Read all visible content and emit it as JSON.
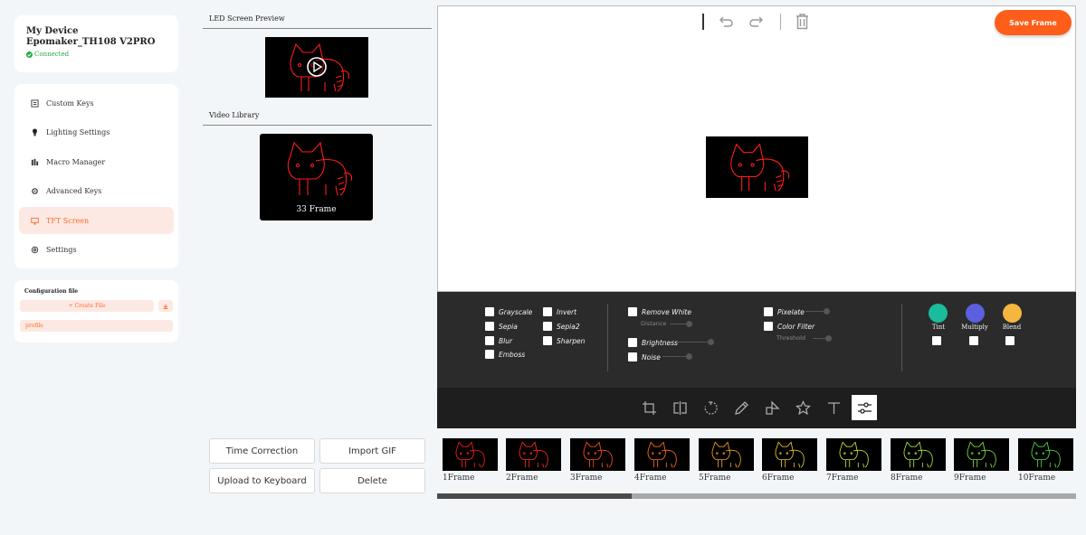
{
  "device": {
    "name": "My Device Epomaker_TH108 V2PRO",
    "status": "Connected",
    "status_color": "#27a745"
  },
  "nav": {
    "items": [
      {
        "label": "Custom Keys",
        "icon": "keys-icon"
      },
      {
        "label": "Lighting Settings",
        "icon": "bulb-icon"
      },
      {
        "label": "Macro Manager",
        "icon": "macro-icon"
      },
      {
        "label": "Advanced Keys",
        "icon": "gear-icon"
      },
      {
        "label": "TFT Screen",
        "icon": "monitor-icon",
        "active": true
      },
      {
        "label": "Settings",
        "icon": "settings-icon"
      }
    ]
  },
  "config": {
    "title": "Configuration file",
    "create_label": "Create File",
    "profile": "profile"
  },
  "preview": {
    "title": "LED Screen Preview"
  },
  "library": {
    "title": "Video Library",
    "item_label": "33 Frame"
  },
  "actions": {
    "time_correction": "Time Correction",
    "import_gif": "Import GIF",
    "upload": "Upload to Keyboard",
    "delete": "Delete"
  },
  "editor": {
    "save_label": "Save Frame",
    "accent": "#ff5d1a"
  },
  "filters": {
    "grayscale": "Grayscale",
    "sepia": "Sepia",
    "blur": "Blur",
    "emboss": "Emboss",
    "invert": "Invert",
    "sepia2": "Sepia2",
    "sharpen": "Sharpen",
    "remove_white": "Remove White",
    "distance": "Distance",
    "brightness": "Brightness",
    "noise": "Noise",
    "pixelate": "Pixelate",
    "color_filter": "Color Filter",
    "threshold": "Threshold"
  },
  "blend": [
    {
      "label": "Tint",
      "color": "#1abc9c"
    },
    {
      "label": "Multiply",
      "color": "#5b5fe0"
    },
    {
      "label": "Blend",
      "color": "#f5b63f"
    }
  ],
  "tools": [
    "crop-icon",
    "flip-icon",
    "rotate-icon",
    "pencil-icon",
    "shapes-icon",
    "star-icon",
    "text-icon",
    "sliders-icon"
  ],
  "frames": [
    {
      "label": "1Frame",
      "color": "#ff1a1a"
    },
    {
      "label": "2Frame",
      "color": "#ff2a1a"
    },
    {
      "label": "3Frame",
      "color": "#ff4a1a"
    },
    {
      "label": "4Frame",
      "color": "#ff6e1a"
    },
    {
      "label": "5Frame",
      "color": "#f0a020"
    },
    {
      "label": "6Frame",
      "color": "#e6c728"
    },
    {
      "label": "7Frame",
      "color": "#cfe030"
    },
    {
      "label": "8Frame",
      "color": "#a8e83a"
    },
    {
      "label": "9Frame",
      "color": "#7ee040"
    },
    {
      "label": "10Frame",
      "color": "#55d845"
    }
  ]
}
